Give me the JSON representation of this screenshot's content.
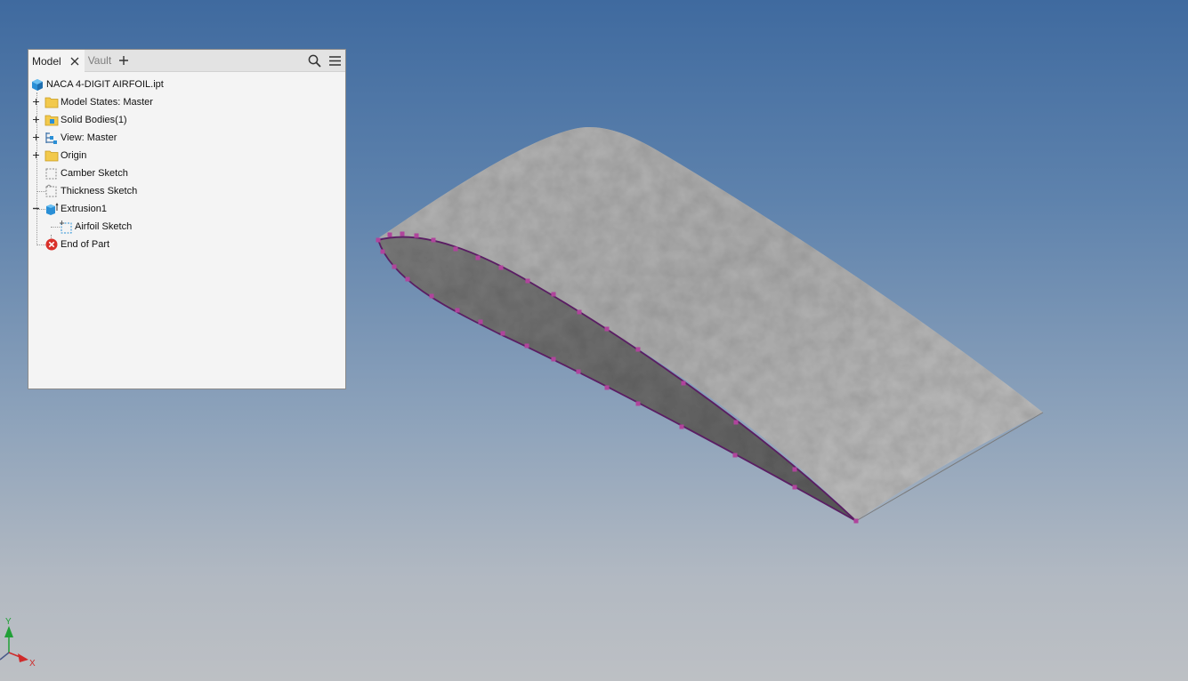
{
  "browser": {
    "tabs": [
      {
        "label": "Model",
        "active": true
      },
      {
        "label": "Vault",
        "active": false
      }
    ],
    "tree": [
      {
        "label": "NACA 4-DIGIT AIRFOIL.ipt",
        "icon": "part-cube-icon"
      },
      {
        "label": "Model States: Master",
        "icon": "folder-icon",
        "expander": "plus"
      },
      {
        "label": "Solid Bodies(1)",
        "icon": "solid-bodies-folder-icon",
        "expander": "plus"
      },
      {
        "label": "View: Master",
        "icon": "view-rep-icon",
        "expander": "plus"
      },
      {
        "label": "Origin",
        "icon": "folder-icon",
        "expander": "plus"
      },
      {
        "label": "Camber Sketch",
        "icon": "sketch-icon"
      },
      {
        "label": "Thickness Sketch",
        "icon": "sketch-icon"
      },
      {
        "label": "Extrusion1",
        "icon": "extrusion-icon",
        "expander": "minus"
      },
      {
        "label": "Airfoil Sketch",
        "icon": "sketch-icon"
      },
      {
        "label": "End of Part",
        "icon": "end-of-part-icon"
      }
    ]
  },
  "triad": {
    "y_label": "Y",
    "x_label": "X"
  },
  "colors": {
    "sketch_curve": "#9a2f8c",
    "sketch_point": "#b0449c",
    "accent_blue": "#2a8fd6",
    "end_of_part_red": "#d9302a",
    "triad_y": "#21a037",
    "triad_x": "#cf2a2a"
  }
}
